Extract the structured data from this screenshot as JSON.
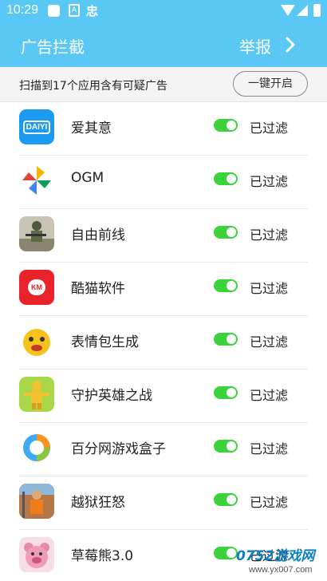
{
  "status_bar": {
    "time": "10:29",
    "icon_mid_letter": "A",
    "icon_right_glyph": "忠"
  },
  "app_bar": {
    "title": "广告拦截",
    "report_label": "举报"
  },
  "info_bar": {
    "message": "扫描到17个应用含有可疑广告",
    "enable_all_label": "一键开启"
  },
  "apps": [
    {
      "name": "爱其意",
      "status": "已过滤",
      "enabled": true,
      "icon": "aiqiyi-app-icon",
      "icon_text": "DAIYI",
      "color": "#1a9af0"
    },
    {
      "name": "OGM",
      "status": "已过滤",
      "enabled": true,
      "icon": "pinwheel-app-icon",
      "color": "#ffffff"
    },
    {
      "name": "自由前线",
      "status": "已过滤",
      "enabled": true,
      "icon": "soldier-app-icon",
      "color": "#7d8a6a"
    },
    {
      "name": "酷猫软件",
      "status": "已过滤",
      "enabled": true,
      "icon": "cat-app-icon",
      "icon_text": "KM",
      "color": "#e8232b"
    },
    {
      "name": "表情包生成",
      "status": "已过滤",
      "enabled": true,
      "icon": "emoji-app-icon",
      "color": "#f7c21b"
    },
    {
      "name": "守护英雄之战",
      "status": "已过滤",
      "enabled": true,
      "icon": "hero-app-icon",
      "color": "#a8d84a"
    },
    {
      "name": "百分网游戏盒子",
      "status": "已过滤",
      "enabled": true,
      "icon": "gamebox-app-icon",
      "color": "#ffffff"
    },
    {
      "name": "越狱狂怒",
      "status": "已过滤",
      "enabled": true,
      "icon": "prison-app-icon",
      "color": "#b5774a"
    },
    {
      "name": "草莓熊3.0",
      "status": "已过滤",
      "enabled": true,
      "icon": "bear-app-icon",
      "color": "#f6dde6"
    }
  ],
  "watermark": {
    "logo": "0752游戏网",
    "url": "www.yx007.com"
  },
  "colors": {
    "accent": "#5ac8f5",
    "toggle_on": "#3ad43a"
  }
}
